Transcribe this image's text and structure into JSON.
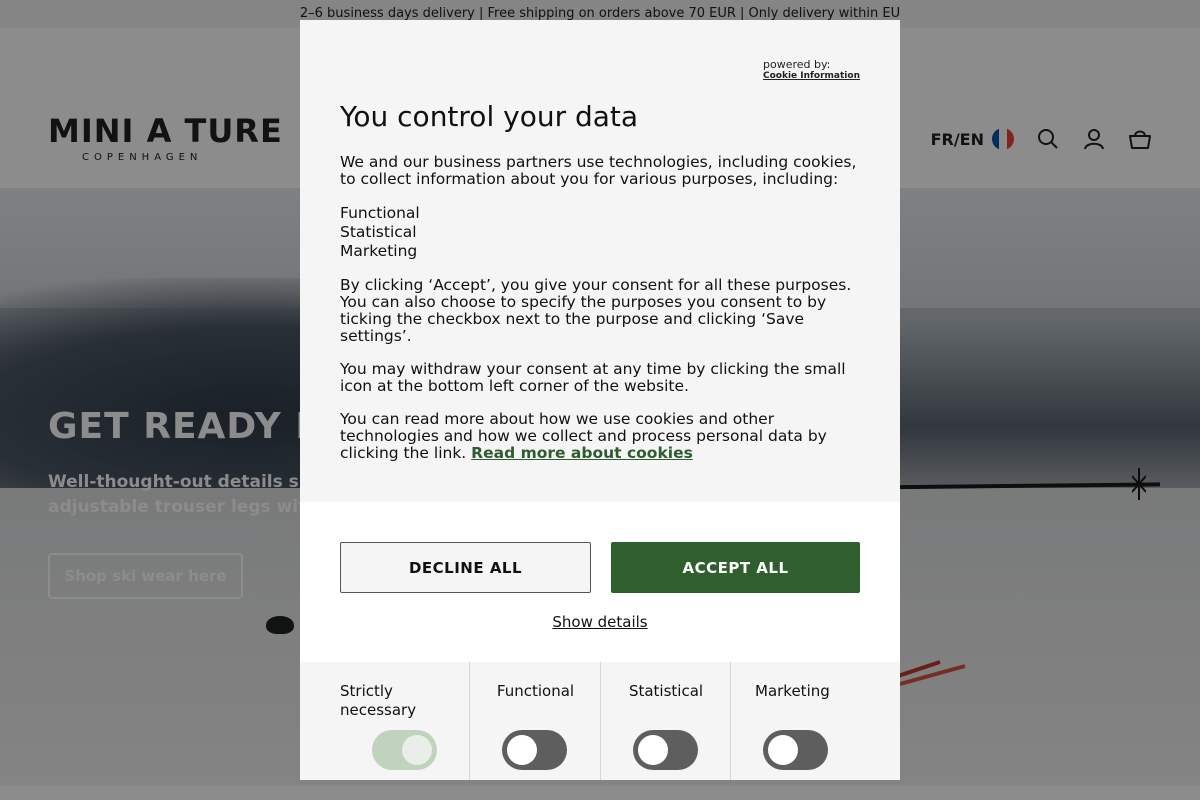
{
  "announcement": "2–6 business days delivery | Free shipping on orders above 70 EUR | Only delivery within EU",
  "header": {
    "logo_main": "MINI A TURE",
    "logo_sub": "COPENHAGEN",
    "language": "FR/EN",
    "flag_colors": [
      "#0055a4",
      "#ffffff",
      "#ef4135"
    ],
    "icons": [
      "search-icon",
      "account-icon",
      "cart-icon"
    ]
  },
  "hero": {
    "title": "GET READY FO",
    "text_line1": "Well-thought-out details suc",
    "text_line2": "adjustable trouser legs with",
    "button": "Shop ski wear here"
  },
  "modal": {
    "powered_label": "powered by:",
    "powered_brand": "Cookie Information",
    "title": "You control your data",
    "intro": "We and our business partners use technologies, including cookies, to collect information about you for various purposes, including:",
    "purposes_list": [
      "Functional",
      "Statistical",
      "Marketing"
    ],
    "consent_text": "By clicking ‘Accept’, you give your consent for all these purposes. You can also choose to specify the purposes you consent to by ticking the checkbox next to the purpose and clicking ‘Save settings’.",
    "withdraw_text": "You may withdraw your consent at any time by clicking the small icon at the bottom left corner of the website.",
    "read_more_text": "You can read more about how we use cookies and other technologies and how we collect and process personal data by clicking the link.",
    "read_more_link": "Read more about cookies",
    "decline_label": "DECLINE ALL",
    "accept_label": "ACCEPT ALL",
    "show_details": "Show details",
    "toggles": [
      {
        "label": "Strictly necessary",
        "on": true,
        "disabled": true
      },
      {
        "label": "Functional",
        "on": false
      },
      {
        "label": "Statistical",
        "on": false
      },
      {
        "label": "Marketing",
        "on": false
      }
    ],
    "accent_color": "#2f5f2d"
  }
}
